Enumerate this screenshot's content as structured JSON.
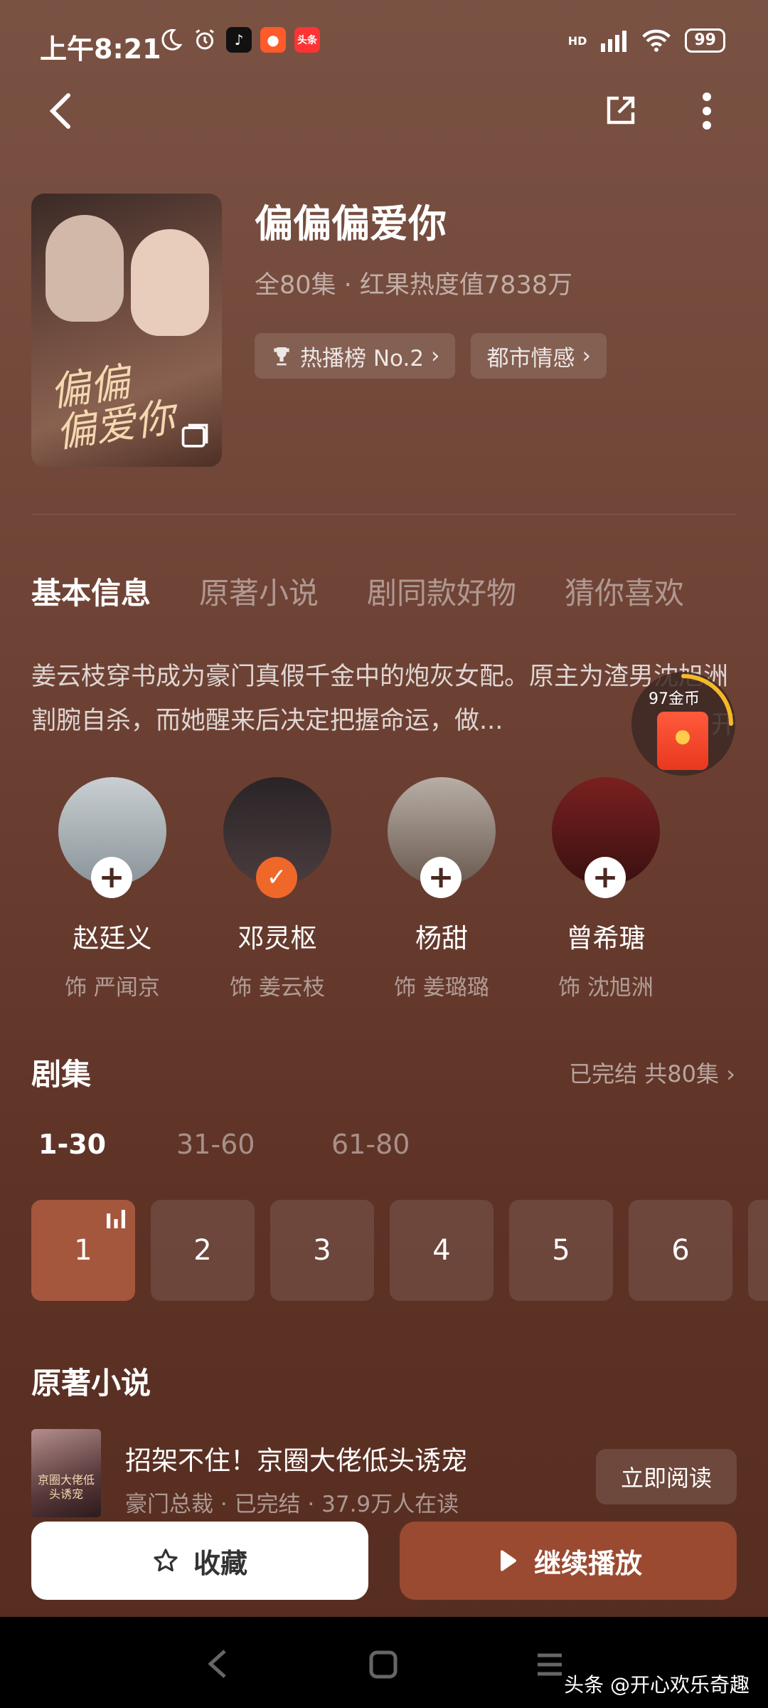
{
  "status_bar": {
    "time": "上午8:21",
    "app_badges": [
      "头条"
    ],
    "network": "HD",
    "battery": "99"
  },
  "top_bar": {
    "back_icon": "back-arrow-icon",
    "share_icon": "share-icon",
    "more_icon": "more-vertical-icon"
  },
  "drama": {
    "poster_title": "偏偏\n偏爱你",
    "title": "偏偏偏爱你",
    "meta": "全80集 · 红果热度值7838万",
    "rank_chip": "热播榜 No.2",
    "genre_chip": "都市情感"
  },
  "tabs": [
    "基本信息",
    "原著小说",
    "剧同款好物",
    "猜你喜欢"
  ],
  "description": "姜云枝穿书成为豪门真假千金中的炮灰女配。原主为渣男沈旭洲割腕自杀，而她醒来后决定把握命运，做...",
  "description_more": "开",
  "reward": {
    "label": "97金币"
  },
  "cast": [
    {
      "name": "赵廷义",
      "role": "饰 严闻京",
      "followed": false,
      "color": "#a9b0b4"
    },
    {
      "name": "邓灵枢",
      "role": "饰 姜云枝",
      "followed": true,
      "color": "#3a3335"
    },
    {
      "name": "杨甜",
      "role": "饰 姜璐璐",
      "followed": false,
      "color": "#8c7d74"
    },
    {
      "name": "曾希瑭",
      "role": "饰 沈旭洲",
      "followed": false,
      "color": "#5a1f1f"
    }
  ],
  "episodes": {
    "title": "剧集",
    "status": "已完结 共80集",
    "ranges": [
      "1-30",
      "31-60",
      "61-80"
    ],
    "active_range": 0,
    "items": [
      "1",
      "2",
      "3",
      "4",
      "5",
      "6"
    ],
    "active_item": 0
  },
  "novel": {
    "section_title": "原著小说",
    "cover_text": "京圈大佬低头诱宠",
    "title": "招架不住！京圈大佬低头诱宠",
    "meta": "豪门总裁 · 已完结 · 37.9万人在读",
    "read_button": "立即阅读"
  },
  "actions": {
    "favorite": "收藏",
    "continue": "继续播放"
  },
  "watermark": "头条 @开心欢乐奇趣",
  "colors": {
    "accent": "#a4573d",
    "continue_bg": "#9a4a31",
    "follow_badge": "#f0672a"
  }
}
